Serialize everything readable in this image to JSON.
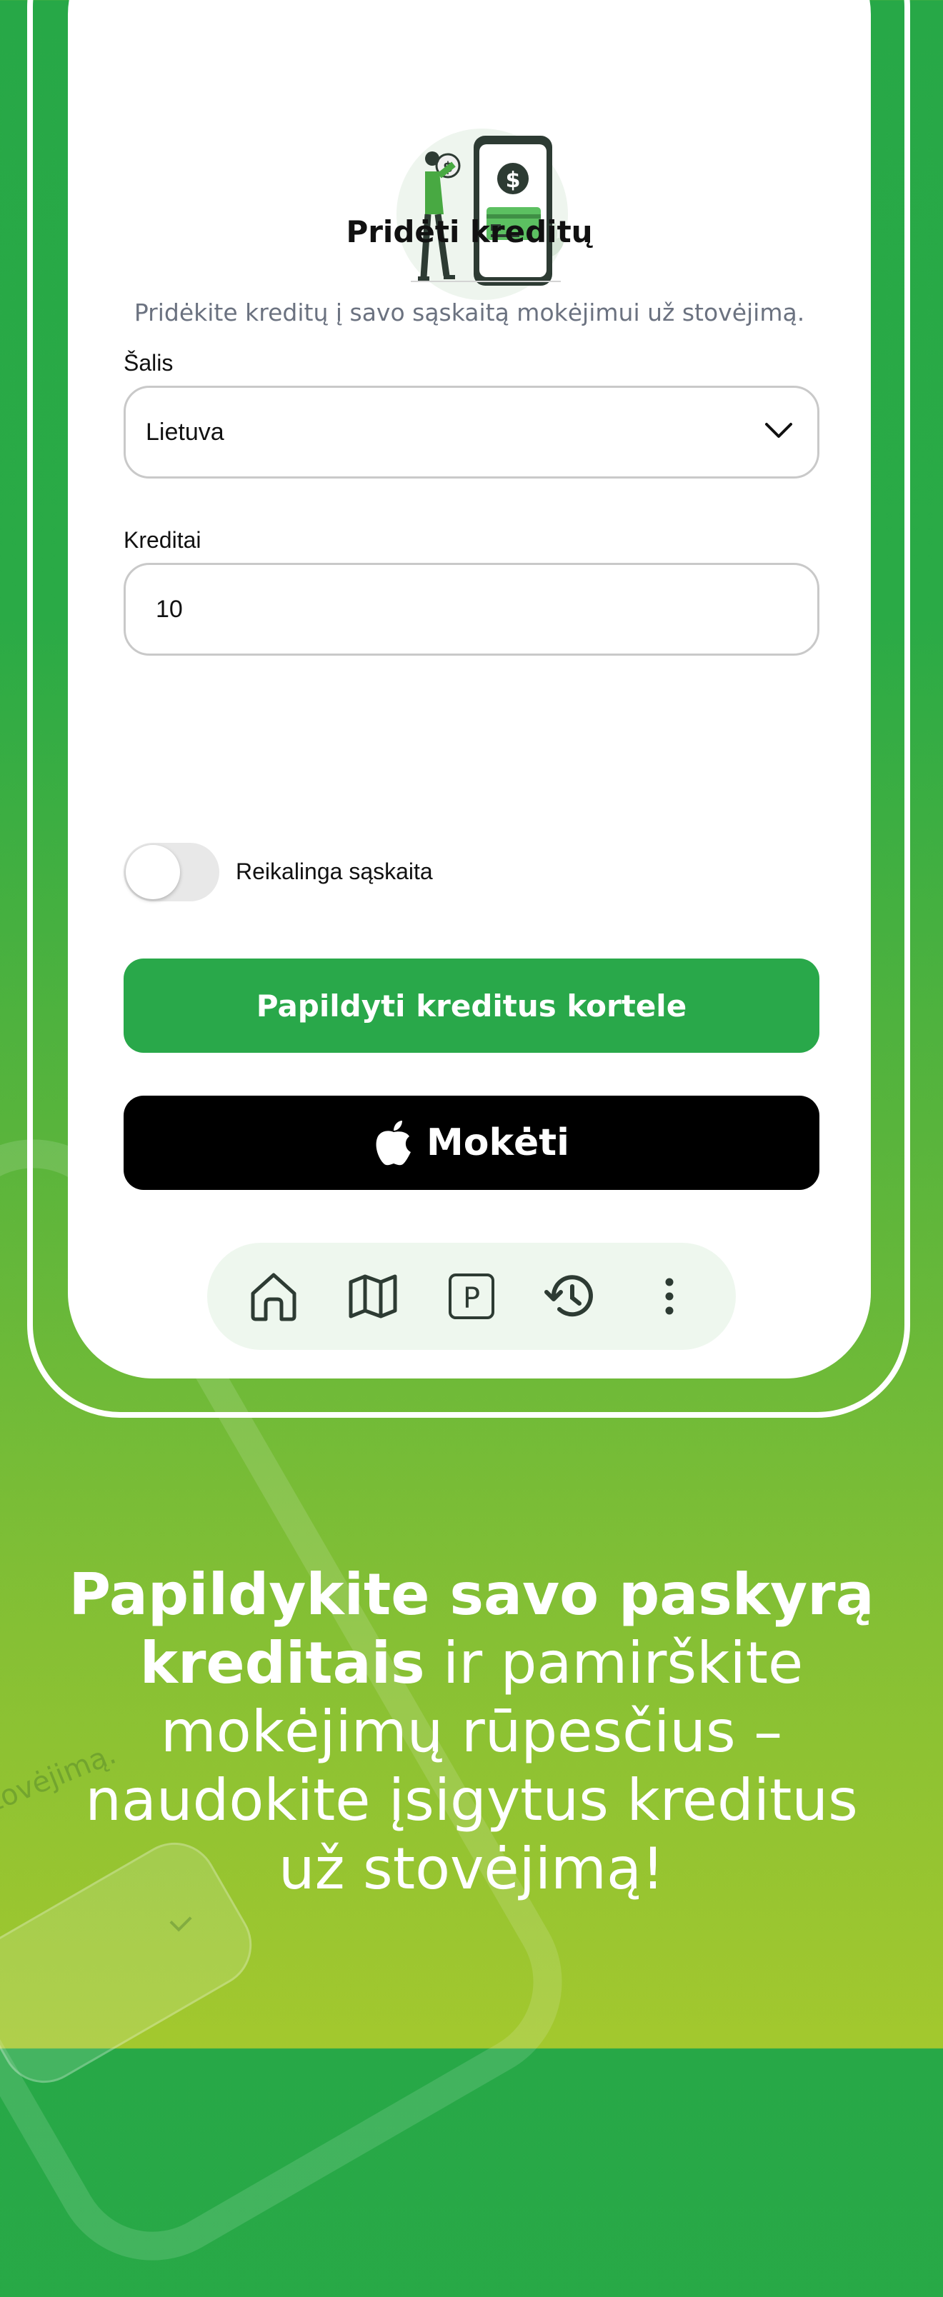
{
  "screen": {
    "title": "Pridėti kreditų",
    "subtitle": "Pridėkite kreditų į savo sąskaitą mokėjimui už stovėjimą.",
    "country": {
      "label": "Šalis",
      "value": "Lietuva"
    },
    "credits": {
      "label": "Kreditai",
      "value": "10"
    },
    "invoice_toggle": {
      "label": "Reikalinga sąskaita",
      "checked": false
    },
    "card_button_label": "Papildyti kreditus kortele",
    "apple_pay_label": "Mokėti",
    "nav": {
      "icons": [
        "home-icon",
        "map-icon",
        "parking-icon",
        "history-icon",
        "more-vertical-icon"
      ]
    }
  },
  "promo": {
    "line1_bold": "Papildykite savo paskyrą",
    "line2_bold": "kreditais",
    "line2_regular": " ir pamirškite",
    "line3": "mokėjimų rūpesčius –",
    "line4": "naudokite įsigytus kreditus",
    "line5": "už stovėjimą!"
  },
  "background_ghost_text": "stovėjimą.",
  "colors": {
    "brand_green": "#29a84a",
    "gradient_bottom": "#a3c82e",
    "apple_button": "#000000"
  }
}
